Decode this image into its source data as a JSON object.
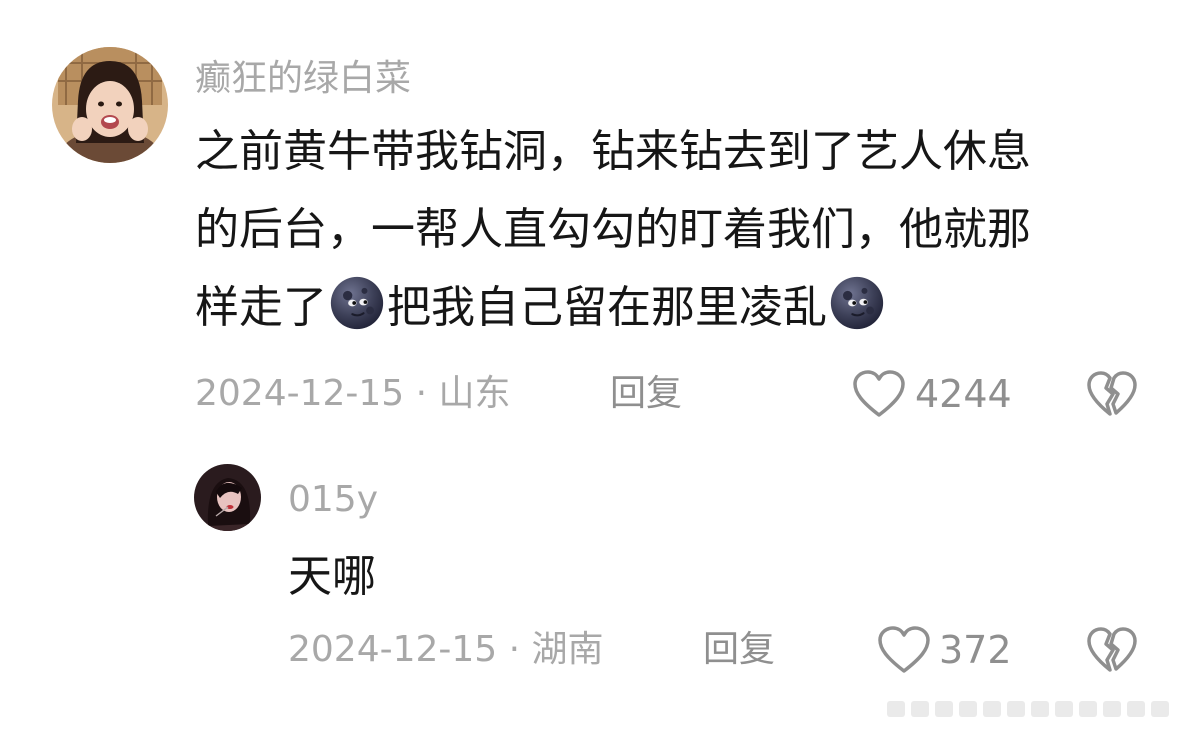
{
  "comments": [
    {
      "username": "癫狂的绿白菜",
      "text_lines": [
        "之前黄牛带我钻洞，钻来钻去到了艺人休息",
        "的后台，一帮人直勾勾的盯着我们，他就那",
        "样走了",
        "把我自己留在那里凌乱"
      ],
      "emoji": "new-moon-face",
      "meta": "2024-12-15 · 山东",
      "reply_label": "回复",
      "likes": "4244"
    }
  ],
  "replies": [
    {
      "username": "015y",
      "text": "天哪",
      "meta": "2024-12-15 · 湖南",
      "reply_label": "回复",
      "likes": "372"
    }
  ],
  "icons": {
    "like": "heart-outline-icon",
    "dislike": "broken-heart-icon"
  },
  "colors": {
    "text": "#161616",
    "muted": "#a8a8a8",
    "icon": "#8f8f8f"
  }
}
